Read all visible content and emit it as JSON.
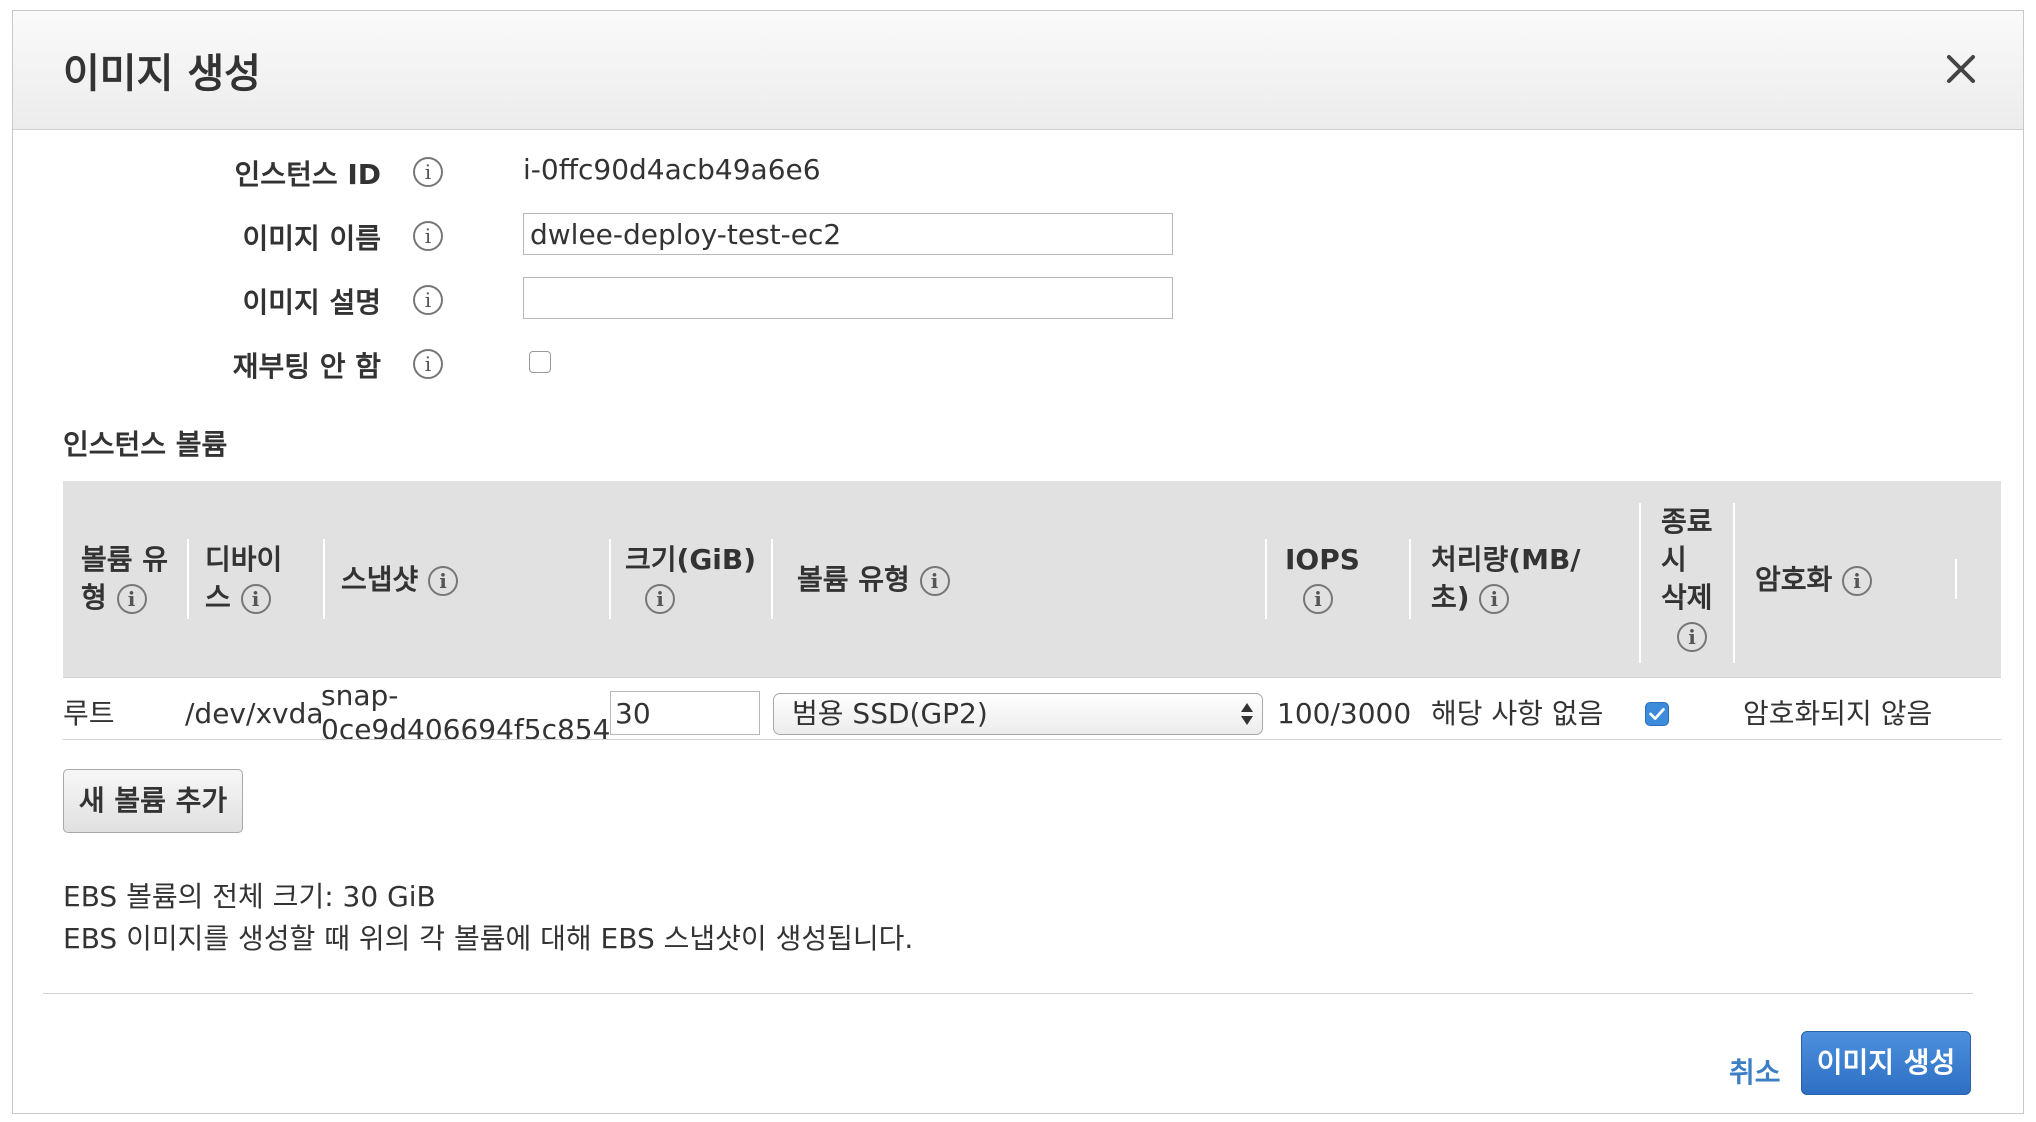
{
  "modal": {
    "title": "이미지 생성"
  },
  "form": {
    "instance_id_label": "인스턴스 ID",
    "instance_id_value": "i-0ffc90d4acb49a6e6",
    "image_name_label": "이미지 이름",
    "image_name_value": "dwlee-deploy-test-ec2",
    "image_desc_label": "이미지 설명",
    "image_desc_value": "",
    "no_reboot_label": "재부팅 안 함",
    "no_reboot_checked": false
  },
  "volumes": {
    "section_title": "인스턴스 볼륨",
    "headers": {
      "volume_type_1": "볼륨 유",
      "volume_type_2": "형",
      "device_1": "디바이",
      "device_2": "스",
      "snapshot": "스냅샷",
      "size_1": "크기(GiB)",
      "volume_kind": "볼륨 유형",
      "iops": "IOPS",
      "throughput_1": "처리량(MB/",
      "throughput_2": "초)",
      "delete_1": "종료",
      "delete_2": "시",
      "delete_3": "삭제",
      "encryption": "암호화"
    },
    "rows": [
      {
        "volume_type": "루트",
        "device": "/dev/xvda",
        "snapshot_1": "snap-",
        "snapshot_2": "0ce9d406694f5c854",
        "size": "30",
        "volume_kind": "범용 SSD(GP2)",
        "iops": "100/3000",
        "throughput": "해당 사항 없음",
        "delete_on_termination": true,
        "encryption": "암호화되지 않음"
      }
    ],
    "add_button": "새 볼륨 추가"
  },
  "info": {
    "total_size": "EBS 볼륨의 전체 크기: 30 GiB",
    "snapshot_note": "EBS 이미지를 생성할 때 위의 각 볼륨에 대해 EBS 스냅샷이 생성됩니다."
  },
  "footer": {
    "cancel_label": "취소",
    "create_label": "이미지 생성"
  },
  "icons": {
    "info": "i"
  },
  "colors": {
    "primary": "#2e6fc3",
    "link": "#3c7fc4",
    "checkbox_checked": "#3d8bdb"
  }
}
